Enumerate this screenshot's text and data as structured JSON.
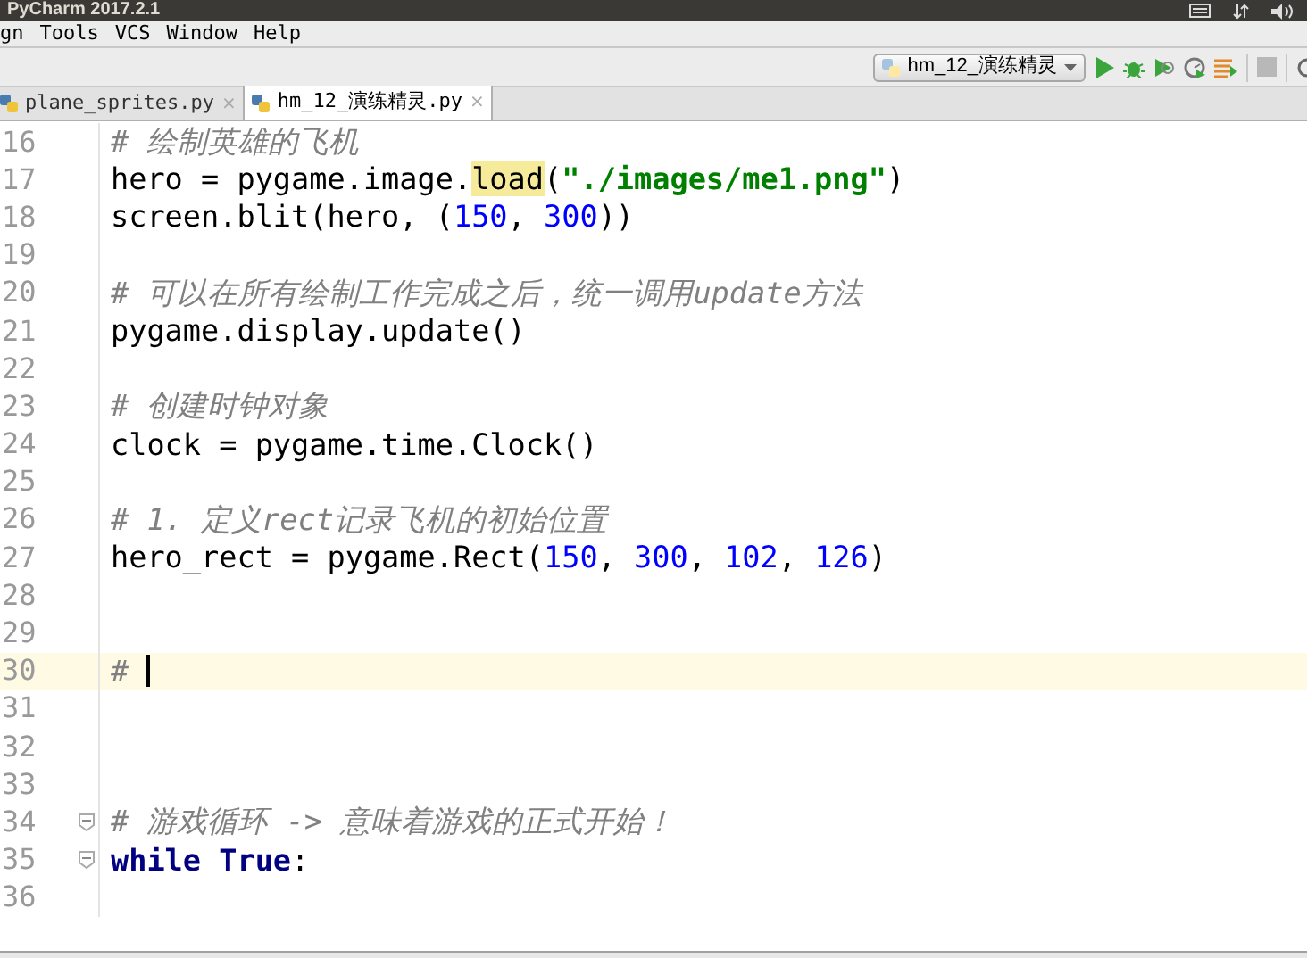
{
  "window": {
    "title": "PyCharm 2017.2.1"
  },
  "menu": [
    "gn",
    "Tools",
    "VCS",
    "Window",
    "Help"
  ],
  "toolbar": {
    "run_config": "hm_12_演练精灵"
  },
  "tabs": [
    {
      "label": "plane_sprites.py",
      "close": "×",
      "selected": false
    },
    {
      "label": "hm_12_演练精灵.py",
      "close": "×",
      "selected": true
    }
  ],
  "editor": {
    "lines": [
      {
        "number": "16",
        "tokens": [
          {
            "kind": "comment",
            "text": "# 绘制英雄的飞机"
          }
        ]
      },
      {
        "number": "17",
        "tokens": [
          {
            "kind": "plain",
            "text": "hero = pygame.image."
          },
          {
            "kind": "match",
            "text": "load"
          },
          {
            "kind": "plain",
            "text": "("
          },
          {
            "kind": "string",
            "text": "\"./images/me1.png\""
          },
          {
            "kind": "plain",
            "text": ")"
          }
        ]
      },
      {
        "number": "18",
        "tokens": [
          {
            "kind": "plain",
            "text": "screen.blit(hero, ("
          },
          {
            "kind": "number",
            "text": "150"
          },
          {
            "kind": "plain",
            "text": ", "
          },
          {
            "kind": "number",
            "text": "300"
          },
          {
            "kind": "plain",
            "text": "))"
          }
        ]
      },
      {
        "number": "19"
      },
      {
        "number": "20",
        "tokens": [
          {
            "kind": "comment",
            "text": "# 可以在所有绘制工作完成之后，统一调用update方法"
          }
        ]
      },
      {
        "number": "21",
        "tokens": [
          {
            "kind": "plain",
            "text": "pygame.display.update()"
          }
        ]
      },
      {
        "number": "22"
      },
      {
        "number": "23",
        "tokens": [
          {
            "kind": "comment",
            "text": "# 创建时钟对象"
          }
        ]
      },
      {
        "number": "24",
        "tokens": [
          {
            "kind": "plain",
            "text": "clock = pygame.time.Clock()"
          }
        ]
      },
      {
        "number": "25"
      },
      {
        "number": "26",
        "tokens": [
          {
            "kind": "comment",
            "text": "# 1. 定义rect记录飞机的初始位置"
          }
        ]
      },
      {
        "number": "27",
        "tokens": [
          {
            "kind": "plain",
            "text": "hero_rect = pygame.Rect("
          },
          {
            "kind": "number",
            "text": "150"
          },
          {
            "kind": "plain",
            "text": ", "
          },
          {
            "kind": "number",
            "text": "300"
          },
          {
            "kind": "plain",
            "text": ", "
          },
          {
            "kind": "number",
            "text": "102"
          },
          {
            "kind": "plain",
            "text": ", "
          },
          {
            "kind": "number",
            "text": "126"
          },
          {
            "kind": "plain",
            "text": ")"
          }
        ]
      },
      {
        "number": "28"
      },
      {
        "number": "29"
      },
      {
        "number": "30",
        "current": true,
        "tokens": [
          {
            "kind": "comment",
            "text": "#"
          }
        ]
      },
      {
        "number": "31"
      },
      {
        "number": "32"
      },
      {
        "number": "33"
      },
      {
        "number": "34",
        "fold": true,
        "tokens": [
          {
            "kind": "comment",
            "text": "# 游戏循环 -> 意味着游戏的正式开始！"
          }
        ]
      },
      {
        "number": "35",
        "fold": true,
        "tokens": [
          {
            "kind": "keyword",
            "text": "while True"
          },
          {
            "kind": "plain",
            "text": ":"
          }
        ]
      },
      {
        "number": "36"
      }
    ]
  }
}
